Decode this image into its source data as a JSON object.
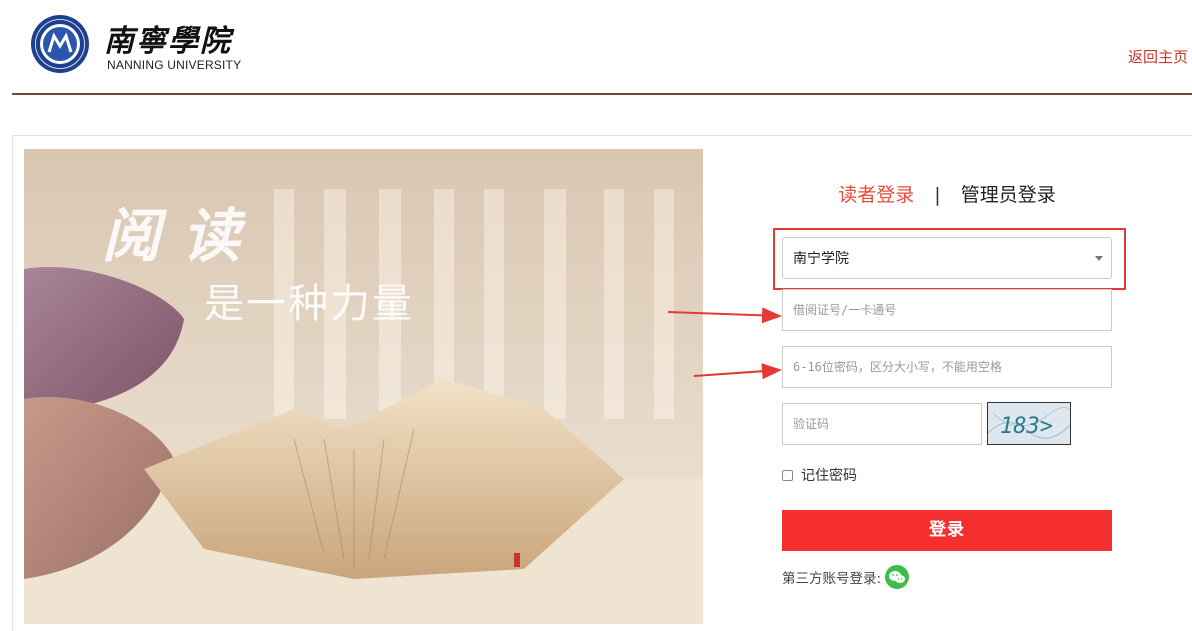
{
  "header": {
    "logo_cn": "南寧學院",
    "logo_en": "NANNING UNIVERSITY",
    "home_link": "返回主页"
  },
  "hero": {
    "line1": "阅读",
    "line2": "是一种力量"
  },
  "login": {
    "tab_reader": "读者登录",
    "tab_separator": "|",
    "tab_admin": "管理员登录",
    "school_select": "南宁学院",
    "card_placeholder": "借阅证号/一卡通号",
    "password_placeholder": "6-16位密码，区分大小写，不能用空格",
    "captcha_placeholder": "验证码",
    "captcha_text": "183>",
    "remember_label": "记住密码",
    "login_button": "登录",
    "third_party_label": "第三方账号登录:"
  },
  "colors": {
    "accent": "#e74c3c",
    "button": "#f52f2f",
    "highlight": "#e53935",
    "header_rule": "#6b4a3a",
    "wechat": "#3fbd4c"
  },
  "icons": {
    "logo": "university-seal-icon",
    "wechat": "wechat-icon",
    "caret": "chevron-down-icon",
    "checkbox": "checkbox-icon"
  }
}
